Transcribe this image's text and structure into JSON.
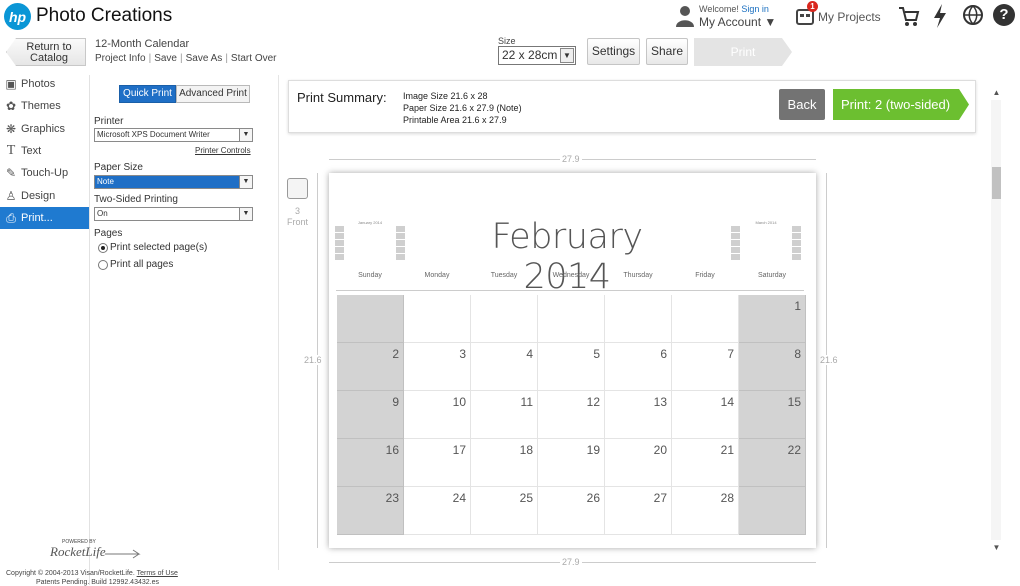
{
  "header": {
    "logo_text": "hp",
    "app_title": "Photo Creations",
    "welcome": "Welcome!",
    "sign_in": "Sign in",
    "my_account": "My Account ▼",
    "notification_count": "1",
    "my_projects": "My Projects"
  },
  "toolbar": {
    "back_catalog_line1": "Return to",
    "back_catalog_line2": "Catalog",
    "project_title": "12-Month Calendar",
    "project_links": [
      "Project Info",
      "Save",
      "Save As",
      "Start Over"
    ],
    "size_label": "Size",
    "size_value": "22 x 28cm",
    "settings": "Settings",
    "share": "Share",
    "print": "Print"
  },
  "sidebar": {
    "items": [
      {
        "label": "Photos",
        "icon": "camera-icon"
      },
      {
        "label": "Themes",
        "icon": "themes-icon"
      },
      {
        "label": "Graphics",
        "icon": "graphics-icon"
      },
      {
        "label": "Text",
        "icon": "text-icon"
      },
      {
        "label": "Touch-Up",
        "icon": "brush-icon"
      },
      {
        "label": "Design",
        "icon": "design-icon"
      },
      {
        "label": "Print...",
        "icon": "printer-icon",
        "active": true
      }
    ]
  },
  "print_panel": {
    "tab_quick": "Quick Print",
    "tab_advanced": "Advanced Print",
    "printer_label": "Printer",
    "printer_value": "Microsoft XPS Document Writer",
    "printer_controls": "Printer Controls",
    "paper_size_label": "Paper Size",
    "paper_size_value": "Note",
    "two_sided_label": "Two-Sided Printing",
    "two_sided_value": "On",
    "pages_label": "Pages",
    "pages_option_selected": "Print selected page(s)",
    "pages_option_all": "Print all pages"
  },
  "footer": {
    "powered_by": "POWERED BY",
    "rocketlife": "RocketLife",
    "copyright": "Copyright © 2004-2013 Visan/RocketLife.",
    "terms": "Terms of Use",
    "patents": "Patents Pending. Build 12992.43432.es"
  },
  "summary": {
    "title": "Print Summary:",
    "image_size": "Image Size 21.6 x 28",
    "paper_size": "Paper Size 21.6 x 27.9 (Note)",
    "printable_area": "Printable Area 21.6 x 27.9",
    "back": "Back",
    "print_button": "Print: 2 (two-sided)"
  },
  "preview": {
    "page_number": "3",
    "page_label": "Front",
    "width_dim": "27.9",
    "height_dim": "21.6",
    "calendar_title": "February 2014",
    "weekdays": [
      "Sunday",
      "Monday",
      "Tuesday",
      "Wednesday",
      "Thursday",
      "Friday",
      "Saturday"
    ],
    "mini_prev_title": "January 2014",
    "mini_next_title": "March 2014",
    "weeks": [
      [
        "",
        "",
        "",
        "",
        "",
        "",
        "1"
      ],
      [
        "2",
        "3",
        "4",
        "5",
        "6",
        "7",
        "8"
      ],
      [
        "9",
        "10",
        "11",
        "12",
        "13",
        "14",
        "15"
      ],
      [
        "16",
        "17",
        "18",
        "19",
        "20",
        "21",
        "22"
      ],
      [
        "23",
        "24",
        "25",
        "26",
        "27",
        "28",
        ""
      ]
    ]
  }
}
